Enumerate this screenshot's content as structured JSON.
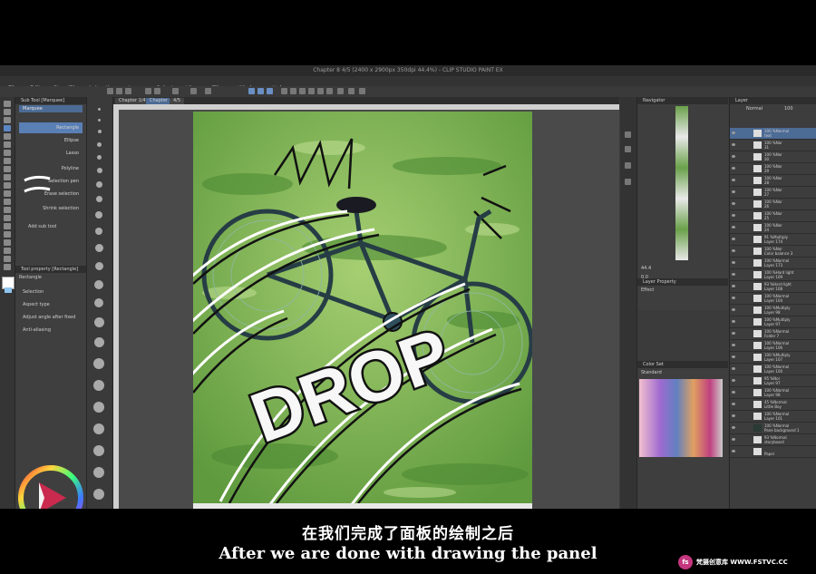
{
  "window": {
    "title": "Chapter 8 4/5 (2400 x 2900px 350dpi 44.4%) - CLIP STUDIO PAINT EX"
  },
  "menu": [
    "File",
    "Edit",
    "Story(P)",
    "Animation",
    "Layer",
    "Select",
    "View",
    "Filter",
    "Window",
    "Help"
  ],
  "canvas_tabs": [
    "Chapter 1/4",
    "Chapter 4 1/3",
    "4/5"
  ],
  "subtool": {
    "title": "Sub Tool [Marquee]",
    "tab": "Marquee",
    "items": [
      "Rectangle",
      "Ellipse",
      "Lasso",
      "Polyline",
      "Selection pen",
      "Erase selection",
      "Shrink selection"
    ],
    "add_label": "Add sub tool"
  },
  "tool_property": {
    "title": "Tool property [Rectangle]",
    "tool": "Rectangle",
    "selection_label": "Selection",
    "aspect_label": "Aspect type",
    "adjust_label": "Adjust angle after fixed",
    "antialias_label": "Anti-aliasing"
  },
  "artwork": {
    "sfx_text": "DROP"
  },
  "navigator": {
    "title": "Navigator",
    "zoom": "44.4",
    "angle": "0.0"
  },
  "layer_property": {
    "title": "Layer Property",
    "effect_label": "Effect"
  },
  "color_set": {
    "title": "Color Set",
    "set_name": "Standard"
  },
  "layer_panel": {
    "title": "Layer",
    "blend": "Normal",
    "opacity": "100",
    "layers": [
      {
        "pct": "100 %Normal",
        "name": "text"
      },
      {
        "pct": "100 %Nor",
        "name": "31"
      },
      {
        "pct": "100 %Nor",
        "name": "30"
      },
      {
        "pct": "100 %Nor",
        "name": "29"
      },
      {
        "pct": "100 %Nor",
        "name": "28"
      },
      {
        "pct": "100 %Nor",
        "name": "27"
      },
      {
        "pct": "100 %Nor",
        "name": "26"
      },
      {
        "pct": "100 %Nor",
        "name": "25"
      },
      {
        "pct": "100 %Nor",
        "name": "24"
      },
      {
        "pct": "91 %Multiply",
        "name": "Layer 174"
      },
      {
        "pct": "100 %Nor",
        "name": "Color balance 3"
      },
      {
        "pct": "100 %Normal",
        "name": "Layer 173"
      },
      {
        "pct": "100 %Hard light",
        "name": "Layer 109"
      },
      {
        "pct": "93 %Hard light",
        "name": "Layer 108"
      },
      {
        "pct": "100 %Normal",
        "name": "Layer 104"
      },
      {
        "pct": "100 %Multiply",
        "name": "Layer 98"
      },
      {
        "pct": "100 %Multiply",
        "name": "Layer 97"
      },
      {
        "pct": "100 %Normal",
        "name": "Folder 7"
      },
      {
        "pct": "100 %Normal",
        "name": "Layer 106"
      },
      {
        "pct": "100 %Multiply",
        "name": "Layer 107"
      },
      {
        "pct": "100 %Normal",
        "name": "Layer 100"
      },
      {
        "pct": "95 %Nor",
        "name": "Layer 97"
      },
      {
        "pct": "100 %Normal",
        "name": "Layer 98"
      },
      {
        "pct": "45 %Normal",
        "name": "Little Boy"
      },
      {
        "pct": "100 %Normal",
        "name": "Layer 101"
      },
      {
        "pct": "100 %Normal",
        "name": "Pane background 1"
      },
      {
        "pct": "93 %Normal",
        "name": "storyboard"
      },
      {
        "pct": "",
        "name": "Paper"
      }
    ]
  },
  "subtitles": {
    "chinese": "在我们完成了面板的绘制之后",
    "english": "After we are done with drawing the panel"
  },
  "watermark": {
    "logo": "fs",
    "text": "梵摄创意库 WWW.FSTVC.CC"
  },
  "colors": {
    "accent": "#4a7ebf",
    "grass": "#78b04a",
    "bike": "#2f4f5e"
  }
}
